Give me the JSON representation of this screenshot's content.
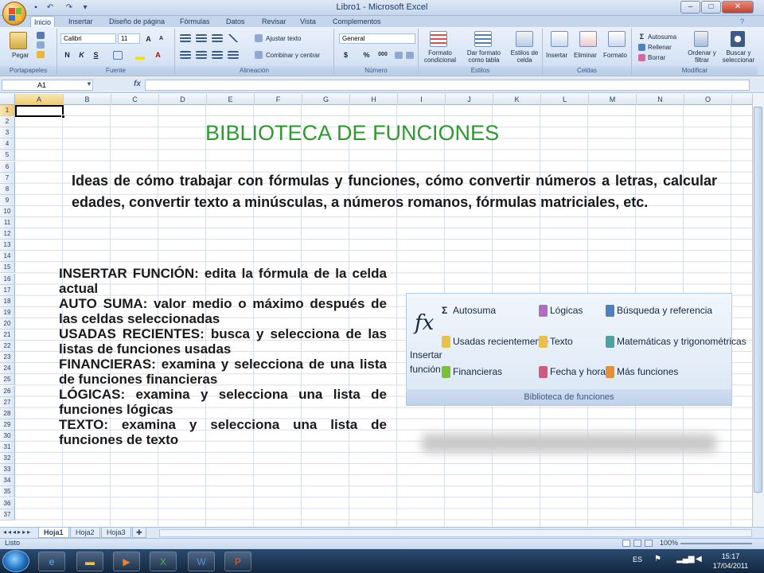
{
  "window": {
    "title": "Libro1 - Microsoft Excel"
  },
  "tabs": [
    "Inicio",
    "Insertar",
    "Diseño de página",
    "Fórmulas",
    "Datos",
    "Revisar",
    "Vista",
    "Complementos"
  ],
  "ribbon": {
    "portapapeles": {
      "paste": "Pegar",
      "label": "Portapapeles"
    },
    "fuente": {
      "font": "Calibri",
      "size": "11",
      "bold": "N",
      "italic": "K",
      "underline": "S",
      "label": "Fuente"
    },
    "alineacion": {
      "wrap": "Ajustar texto",
      "merge": "Combinar y centrar",
      "label": "Alineación"
    },
    "numero": {
      "format": "General",
      "currency": "$",
      "percent": "%",
      "thousands": "000",
      "label": "Número"
    },
    "estilos": {
      "conditional": "Formato condicional",
      "table": "Dar formato como tabla",
      "cell_styles": "Estilos de celda",
      "label": "Estilos"
    },
    "celdas": {
      "insert": "Insertar",
      "delete": "Eliminar",
      "format": "Formato",
      "label": "Celdas"
    },
    "modificar": {
      "autosum": "Autosuma",
      "fill": "Rellenar",
      "clear": "Borrar",
      "sort": "Ordenar y filtrar",
      "find": "Buscar y seleccionar",
      "label": "Modificar"
    }
  },
  "formula_bar": {
    "name_box": "A1",
    "fx": "fx",
    "value": ""
  },
  "columns": [
    "A",
    "B",
    "C",
    "D",
    "E",
    "F",
    "G",
    "H",
    "I",
    "J",
    "K",
    "L",
    "M",
    "N",
    "O"
  ],
  "rows": [
    "1",
    "2",
    "3",
    "4",
    "5",
    "6",
    "7",
    "8",
    "9",
    "10",
    "11",
    "12",
    "13",
    "14",
    "15",
    "16",
    "17",
    "18",
    "19",
    "20",
    "21",
    "22",
    "23",
    "24",
    "25",
    "26",
    "27",
    "28",
    "29",
    "30",
    "31",
    "32",
    "33",
    "34",
    "35",
    "36",
    "37"
  ],
  "content": {
    "title": "BIBLIOTECA DE FUNCIONES",
    "intro": "Ideas de cómo trabajar con fórmulas y funciones, cómo convertir números a letras, calcular edades, convertir texto a minúsculas, a números romanos, fórmulas matriciales, etc.",
    "items": [
      "INSERTAR FUNCIÓN: edita la fórmula de la celda actual",
      "AUTO SUMA: valor medio o máximo después de las celdas seleccionadas",
      "USADAS RECIENTES: busca y selecciona de las listas de funciones usadas",
      "FINANCIERAS: examina y selecciona de una lista de funciones financieras",
      "LÓGICAS: examina y selecciona una lista de funciones lógicas",
      "TEXTO: examina y selecciona una lista de funciones de texto"
    ]
  },
  "library_image": {
    "insert_function": "Insertar función",
    "fx": "fx",
    "autosum": "Autosuma",
    "recent": "Usadas recientemente",
    "financial": "Financieras",
    "logical": "Lógicas",
    "text": "Texto",
    "datetime": "Fecha y hora",
    "lookup": "Búsqueda y referencia",
    "math": "Matemáticas y trigonométricas",
    "more": "Más funciones",
    "label": "Biblioteca de funciones"
  },
  "sheets": [
    "Hoja1",
    "Hoja2",
    "Hoja3"
  ],
  "status": {
    "text": "Listo",
    "zoom": "100%"
  },
  "taskbar": {
    "lang": "ES",
    "time": "15:17",
    "date": "17/04/2011"
  },
  "colors": {
    "title_green": "#2f9a2f",
    "ribbon_blue": "#dae6f6"
  }
}
